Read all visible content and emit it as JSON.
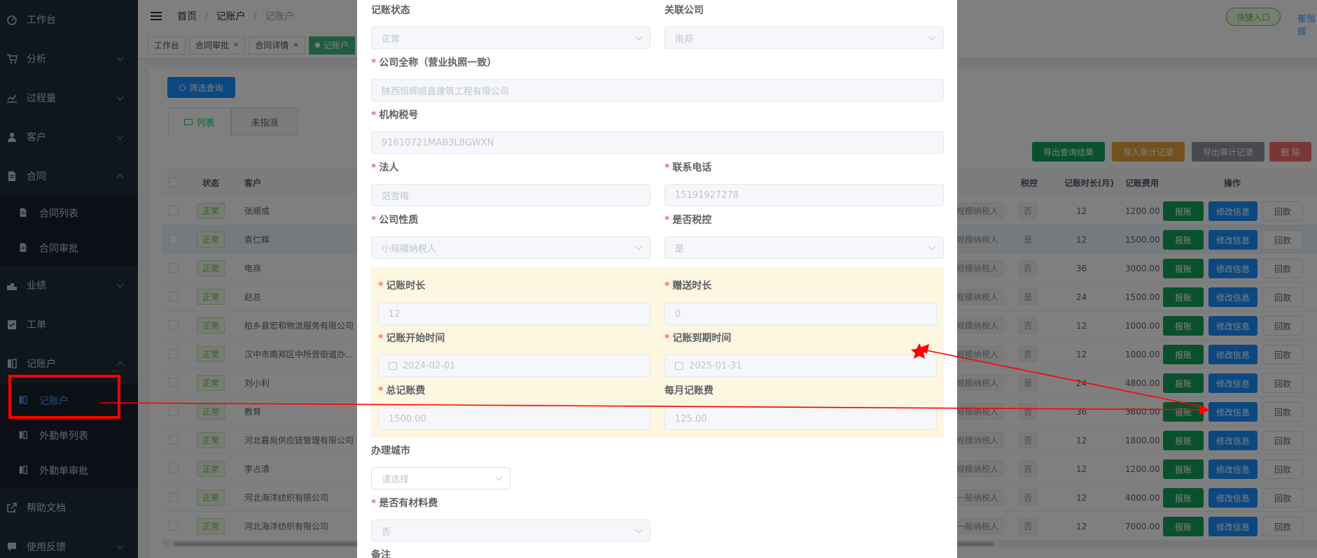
{
  "sidebar": {
    "items": [
      {
        "label": "工作台",
        "icon": "dashboard-icon"
      },
      {
        "label": "分析",
        "icon": "cart-icon"
      },
      {
        "label": "过程量",
        "icon": "chart-icon"
      },
      {
        "label": "客户",
        "icon": "user-icon"
      },
      {
        "label": "合同",
        "icon": "document-icon"
      }
    ],
    "contract_sub": [
      "合同列表",
      "合同审批"
    ],
    "items2": [
      {
        "label": "业绩",
        "icon": "trophy-icon"
      },
      {
        "label": "工单",
        "icon": "clipboard-icon"
      },
      {
        "label": "记账户",
        "icon": "book-icon"
      }
    ],
    "account_sub": [
      "记账户",
      "外勤单列表",
      "外勤单审批"
    ],
    "items3": [
      {
        "label": "帮助文档",
        "icon": "external-link-icon"
      },
      {
        "label": "使用反馈",
        "icon": "feedback-icon"
      }
    ]
  },
  "navbar": {
    "breadcrumb": [
      "首页",
      "记账户",
      "记账户"
    ],
    "quick_entry": "快捷入口",
    "user": "崔恒辉"
  },
  "tags": [
    "工作台",
    "合同审批",
    "合同详情",
    "记账户"
  ],
  "toolbar": {
    "filter_btn": "筛选查询",
    "tabs": [
      "列表",
      "未指派"
    ],
    "export_btn": "导出查询结果",
    "import_btn": "导入审计记录",
    "export_audit_btn": "导出审计记录",
    "delete_btn": "删 除"
  },
  "table": {
    "headers": [
      "状态",
      "客户",
      "税控",
      "记账时长(月)",
      "记账费用",
      "操作"
    ],
    "rows": [
      {
        "status": "正常",
        "customer": "张顺成",
        "type": "规模纳税人",
        "tax": "否",
        "months": "12",
        "fee": "1200.00"
      },
      {
        "status": "正常",
        "customer": "袁仁辉",
        "type": "规模纳税人",
        "tax": "是",
        "months": "12",
        "fee": "1500.00"
      },
      {
        "status": "正常",
        "customer": "电商",
        "type": "规模纳税人",
        "tax": "否",
        "months": "36",
        "fee": "3000.00"
      },
      {
        "status": "正常",
        "customer": "赵总",
        "type": "规模纳税人",
        "tax": "是",
        "months": "24",
        "fee": "1500.00"
      },
      {
        "status": "正常",
        "customer": "柏乡县宏和物流服务有限公司",
        "type": "规模纳税人",
        "tax": "否",
        "months": "12",
        "fee": "1000.00"
      },
      {
        "status": "正常",
        "customer": "汉中市南郑区中所营街道办...",
        "type": "规模纳税人",
        "tax": "否",
        "months": "12",
        "fee": "1000.00"
      },
      {
        "status": "正常",
        "customer": "刘小利",
        "type": "规模纳税人",
        "tax": "是",
        "months": "24",
        "fee": "4800.00"
      },
      {
        "status": "正常",
        "customer": "教育",
        "type": "规模纳税人",
        "tax": "否",
        "months": "36",
        "fee": "3600.00"
      },
      {
        "status": "正常",
        "customer": "河北暮尚供应链管理有限公司",
        "type": "规模纳税人",
        "tax": "否",
        "months": "12",
        "fee": "1800.00"
      },
      {
        "status": "正常",
        "customer": "李占清",
        "type": "规模纳税人",
        "tax": "否",
        "months": "12",
        "fee": "1200.00"
      },
      {
        "status": "正常",
        "customer": "河北海洋纺织有限公司",
        "type": "一般纳税人",
        "tax": "否",
        "months": "12",
        "fee": "4000.00"
      },
      {
        "status": "正常",
        "customer": "河北海洋纺织有限公司",
        "type": "一般纳税人",
        "tax": "否",
        "months": "12",
        "fee": "7000.00"
      }
    ],
    "op_labels": [
      "报账",
      "修改信息",
      "回款"
    ]
  },
  "dialog": {
    "status_label": "记账状态",
    "status_value": "正常",
    "company_label": "关联公司",
    "company_value": "南郑",
    "fullname_label": "公司全称（营业执照一致）",
    "fullname_value": "陕西恒辉顺昌建筑工程有限公司",
    "taxno_label": "机构税号",
    "taxno_value": "91610721MAB3L8GWXN",
    "legal_label": "法人",
    "legal_value": "范雪梅",
    "phone_label": "联系电话",
    "phone_value": "15191927278",
    "nature_label": "公司性质",
    "nature_value": "小规模纳税人",
    "taxctl_label": "是否税控",
    "taxctl_value": "是",
    "duration_label": "记账时长",
    "duration_value": "12",
    "gift_label": "赠送时长",
    "gift_value": "0",
    "start_label": "记账开始时间",
    "start_value": "2024-02-01",
    "end_label": "记账到期时间",
    "end_value": "2025-01-31",
    "total_label": "总记账费",
    "total_value": "1500.00",
    "monthly_label": "每月记账费",
    "monthly_value": "125.00",
    "city_label": "办理城市",
    "city_placeholder": "请选择",
    "material_label": "是否有材料费",
    "material_value": "否",
    "remark_label": "备注"
  },
  "colors": {
    "sidebar_bg": "#1f2d3d",
    "accent": "#409eff",
    "success": "#13a35a",
    "annotation_red": "#ff0000"
  }
}
